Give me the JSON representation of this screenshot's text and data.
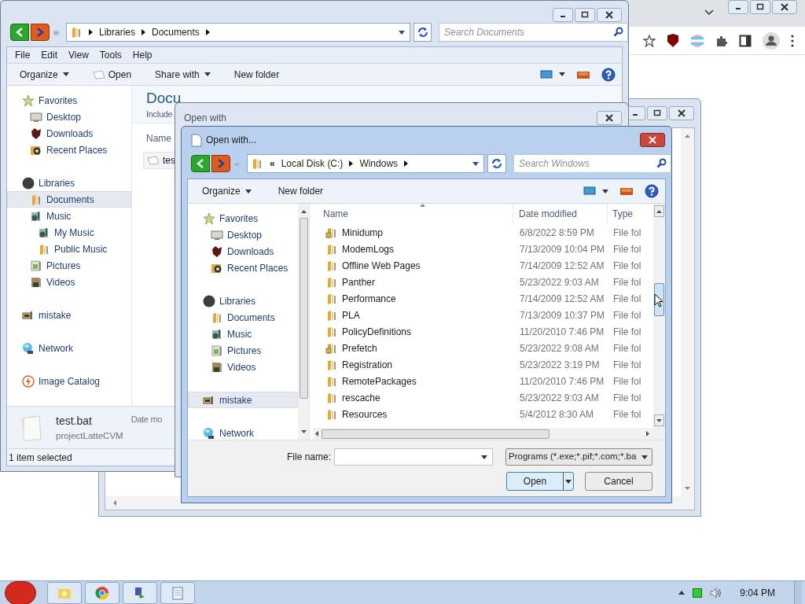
{
  "explorer": {
    "address": [
      "Libraries",
      "Documents"
    ],
    "search_placeholder": "Search Documents",
    "menu": [
      "File",
      "Edit",
      "View",
      "Tools",
      "Help"
    ],
    "toolbar": [
      {
        "label": "Organize",
        "kind": "menu"
      },
      {
        "label": "Open",
        "kind": "open"
      },
      {
        "label": "Share with",
        "kind": "menu"
      },
      {
        "label": "New folder",
        "kind": "plain"
      }
    ],
    "nav": [
      {
        "label": "Favorites",
        "kind": "favorites",
        "selected": false,
        "children": [
          {
            "label": "Desktop",
            "kind": "desktop",
            "selected": false
          },
          {
            "label": "Downloads",
            "kind": "downloads",
            "selected": false
          },
          {
            "label": "Recent Places",
            "kind": "recent",
            "selected": false
          }
        ]
      },
      {
        "label": "Libraries",
        "kind": "libraries",
        "selected": false,
        "children": [
          {
            "label": "Documents",
            "kind": "folder",
            "selected": true
          },
          {
            "label": "Music",
            "kind": "music",
            "selected": false,
            "children": [
              {
                "label": "My Music",
                "kind": "music",
                "selected": false
              },
              {
                "label": "Public Music",
                "kind": "folder",
                "selected": false
              }
            ]
          },
          {
            "label": "Pictures",
            "kind": "pictures",
            "selected": false
          },
          {
            "label": "Videos",
            "kind": "videos",
            "selected": false
          }
        ]
      },
      {
        "label": "mistake",
        "kind": "computer",
        "selected": false
      },
      {
        "label": "Network",
        "kind": "network",
        "selected": false
      },
      {
        "label": "Image Catalog",
        "kind": "catalog",
        "selected": false
      }
    ],
    "heading": "Docu",
    "subheading": "Include",
    "column": "Name",
    "files": [
      {
        "name": "tes",
        "selected": true
      }
    ],
    "details": {
      "name": "test.bat",
      "location": "projectLatteCVM",
      "field": "Date mo"
    },
    "status": "1 item selected"
  },
  "open_with": {
    "title": "Open with"
  },
  "dialog": {
    "title": "Open with...",
    "overflow": "«",
    "address": [
      "Local Disk (C:)",
      "Windows"
    ],
    "search_placeholder": "Search Windows",
    "toolbar": [
      {
        "label": "Organize",
        "kind": "menu"
      },
      {
        "label": "New folder",
        "kind": "plain"
      }
    ],
    "nav": [
      {
        "label": "Favorites",
        "kind": "favorites",
        "selected": false,
        "children": [
          {
            "label": "Desktop",
            "kind": "desktop",
            "selected": false
          },
          {
            "label": "Downloads",
            "kind": "downloads",
            "selected": false
          },
          {
            "label": "Recent Places",
            "kind": "recent",
            "selected": false
          }
        ]
      },
      {
        "label": "Libraries",
        "kind": "libraries",
        "selected": false,
        "children": [
          {
            "label": "Documents",
            "kind": "folder",
            "selected": false
          },
          {
            "label": "Music",
            "kind": "music",
            "selected": false
          },
          {
            "label": "Pictures",
            "kind": "pictures",
            "selected": false
          },
          {
            "label": "Videos",
            "kind": "videos",
            "selected": false
          }
        ]
      },
      {
        "label": "mistake",
        "kind": "computer",
        "selected": true
      },
      {
        "label": "Network",
        "kind": "network",
        "selected": false
      }
    ],
    "columns": [
      "Name",
      "Date modified",
      "Type"
    ],
    "rows": [
      {
        "name": "Minidump",
        "date": "6/8/2022 8:59 PM",
        "type": "File fol",
        "locked": true
      },
      {
        "name": "ModemLogs",
        "date": "7/13/2009 10:04 PM",
        "type": "File fol",
        "locked": false
      },
      {
        "name": "Offline Web Pages",
        "date": "7/14/2009 12:52 AM",
        "type": "File fol",
        "locked": false
      },
      {
        "name": "Panther",
        "date": "5/23/2022 9:03 AM",
        "type": "File fol",
        "locked": false
      },
      {
        "name": "Performance",
        "date": "7/14/2009 12:52 AM",
        "type": "File fol",
        "locked": false
      },
      {
        "name": "PLA",
        "date": "7/13/2009 10:37 PM",
        "type": "File fol",
        "locked": false
      },
      {
        "name": "PolicyDefinitions",
        "date": "11/20/2010 7:46 PM",
        "type": "File fol",
        "locked": false
      },
      {
        "name": "Prefetch",
        "date": "5/23/2022 9:08 AM",
        "type": "File fol",
        "locked": true
      },
      {
        "name": "Registration",
        "date": "5/23/2022 3:19 PM",
        "type": "File fol",
        "locked": false
      },
      {
        "name": "RemotePackages",
        "date": "11/20/2010 7:46 PM",
        "type": "File fol",
        "locked": false
      },
      {
        "name": "rescache",
        "date": "5/23/2022 9:03 AM",
        "type": "File fol",
        "locked": false
      },
      {
        "name": "Resources",
        "date": "5/4/2012 8:30 AM",
        "type": "File fol",
        "locked": false
      }
    ],
    "file_name_label": "File name:",
    "filter": "Programs (*.exe;*.pif;*.com;*.ba",
    "buttons": [
      {
        "label": "Open",
        "kind": "split",
        "selected": true
      },
      {
        "label": "Cancel",
        "kind": "plain",
        "selected": false
      }
    ]
  },
  "taskbar": {
    "clock": "9:04 PM"
  }
}
